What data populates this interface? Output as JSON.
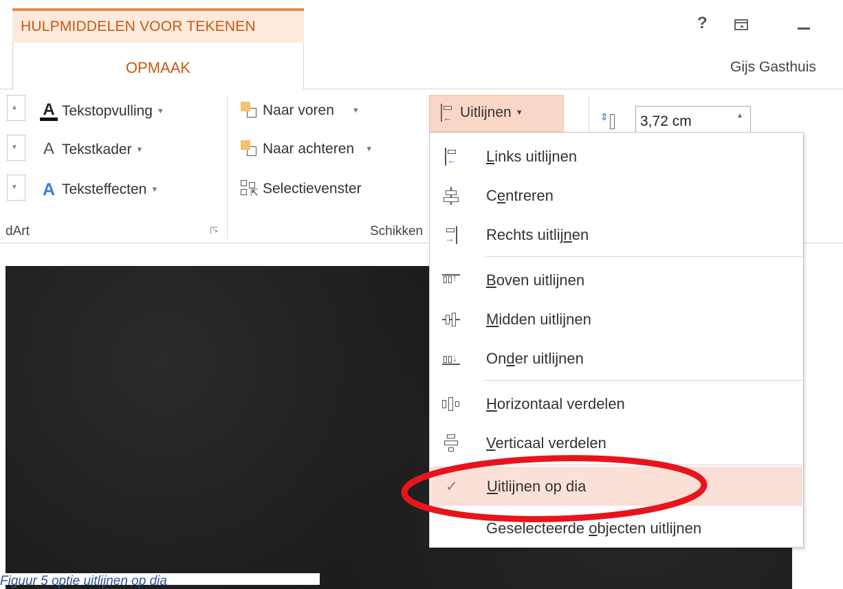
{
  "window": {
    "help_glyph": "?",
    "user_name": "Gijs Gasthuis"
  },
  "context_tab": {
    "header": "HULPMIDDELEN VOOR TEKENEN",
    "tab": "OPMAAK"
  },
  "ribbon": {
    "wordart_group": {
      "label": "dArt",
      "buttons": [
        {
          "label": "Tekstopvulling",
          "icon": "text-fill-icon"
        },
        {
          "label": "Tekstkader",
          "icon": "text-outline-icon"
        },
        {
          "label": "Teksteffecten",
          "icon": "text-effects-icon"
        }
      ]
    },
    "arrange_group": {
      "label": "Schikken",
      "buttons": [
        {
          "label": "Naar voren",
          "icon": "bring-forward-icon"
        },
        {
          "label": "Naar achteren",
          "icon": "send-backward-icon"
        },
        {
          "label": "Selectievenster",
          "icon": "selection-pane-icon"
        }
      ],
      "align_button": {
        "label": "Uitlijnen",
        "icon": "align-icon",
        "state": "open"
      }
    },
    "size_group": {
      "height_value": "3,72 cm"
    }
  },
  "align_menu": {
    "items": [
      {
        "pre": "",
        "u": "L",
        "post": "inks uitlijnen",
        "icon": "align-left-icon"
      },
      {
        "pre": "C",
        "u": "e",
        "post": "ntreren",
        "icon": "align-center-icon"
      },
      {
        "pre": "Rechts uitlij",
        "u": "n",
        "post": "en",
        "icon": "align-right-icon"
      },
      {
        "pre": "",
        "u": "B",
        "post": "oven uitlijnen",
        "icon": "align-top-icon"
      },
      {
        "pre": "",
        "u": "M",
        "post": "idden uitlijnen",
        "icon": "align-middle-icon"
      },
      {
        "pre": "On",
        "u": "d",
        "post": "er uitlijnen",
        "icon": "align-bottom-icon"
      },
      {
        "pre": "",
        "u": "H",
        "post": "orizontaal verdelen",
        "icon": "distribute-horizontally-icon"
      },
      {
        "pre": "",
        "u": "V",
        "post": "erticaal verdelen",
        "icon": "distribute-vertically-icon"
      },
      {
        "pre": "",
        "u": "U",
        "post": "itlijnen op dia",
        "icon": "check-icon",
        "checked": true
      },
      {
        "pre": "Geselecteerde ",
        "u": "o",
        "post": "bjecten uitlijnen",
        "icon": ""
      }
    ]
  },
  "caption": "Figuur 5 optie uitlijnen op dia",
  "colors": {
    "accent": "#c55a11",
    "highlight": "#f9d6c6",
    "annotation": "#e8141c"
  }
}
